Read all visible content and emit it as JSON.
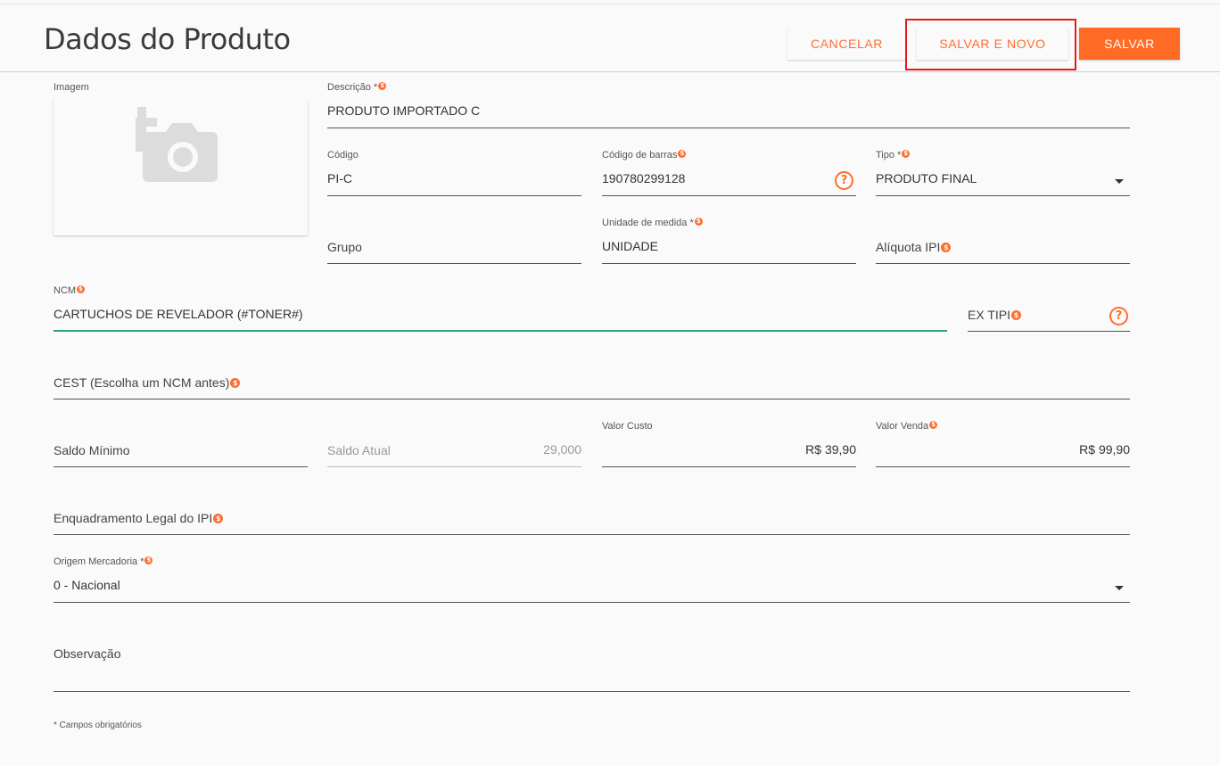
{
  "header": {
    "title": "Dados do Produto",
    "cancel_label": "CANCELAR",
    "save_new_label": "SALVAR E NOVO",
    "save_label": "SALVAR"
  },
  "image": {
    "label": "Imagem",
    "icon": "add-photo-icon"
  },
  "fields": {
    "descricao": {
      "label": "Descrição *",
      "value": "PRODUTO IMPORTADO C"
    },
    "codigo": {
      "label": "Código",
      "value": "PI-C"
    },
    "codigo_barras": {
      "label": "Código de barras",
      "value": "190780299128"
    },
    "tipo": {
      "label": "Tipo *",
      "value": "PRODUTO FINAL"
    },
    "grupo": {
      "placeholder": "Grupo"
    },
    "unidade": {
      "label": "Unidade de medida *",
      "value": "UNIDADE"
    },
    "aliquota_ipi": {
      "placeholder": "Alíquota IPI"
    },
    "ncm": {
      "label": "NCM",
      "value": "CARTUCHOS DE REVELADOR (#TONER#)"
    },
    "ex_tipi": {
      "placeholder": "EX TIPI"
    },
    "cest": {
      "placeholder": "CEST (Escolha um NCM antes)"
    },
    "saldo_minimo": {
      "placeholder": "Saldo Mínimo"
    },
    "saldo_atual": {
      "placeholder": "Saldo Atual",
      "value": "29,000"
    },
    "valor_custo": {
      "label": "Valor Custo",
      "value": "R$ 39,90"
    },
    "valor_venda": {
      "label": "Valor Venda",
      "value": "R$ 99,90"
    },
    "enquadramento": {
      "placeholder": "Enquadramento Legal do IPI"
    },
    "origem": {
      "label": "Origem Mercadoria *",
      "value": "0 - Nacional"
    },
    "observacao": {
      "placeholder": "Observação"
    }
  },
  "footnote": "* Campos obrigatórios",
  "colors": {
    "accent": "#ff6d2e",
    "focus": "#2e9e82",
    "highlight": "#e41b1b"
  }
}
